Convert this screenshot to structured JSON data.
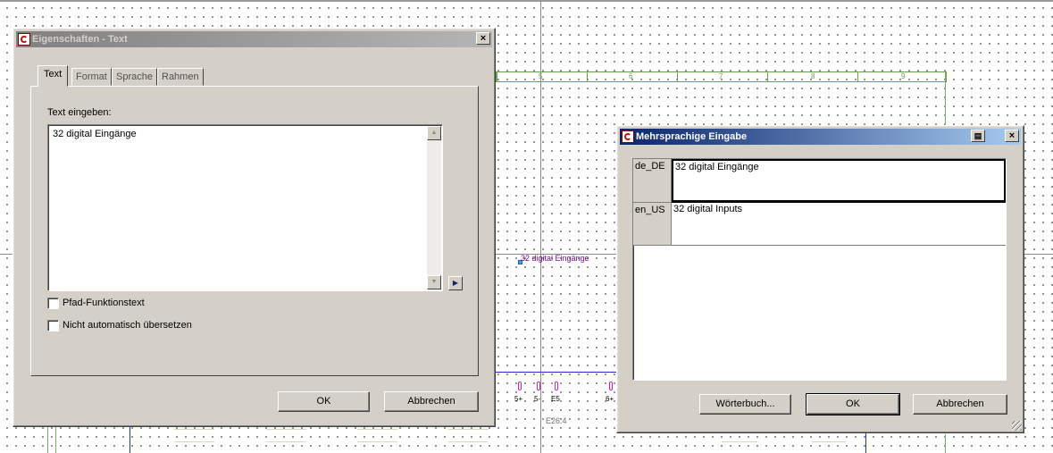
{
  "canvas": {
    "ruler_numbers": [
      "5",
      "6",
      "7",
      "8",
      "9"
    ],
    "text_label": "32 digital Eingänge",
    "terminals": [
      "5+",
      "5-",
      "E5",
      "6+"
    ],
    "device_label": "E26.4"
  },
  "props_dialog": {
    "title": "Eigenschaften - Text",
    "close_glyph": "×",
    "tabs": [
      "Text",
      "Format",
      "Sprache",
      "Rahmen"
    ],
    "text_label": "Text eingeben:",
    "text_value": "32 digital Eingänge",
    "checkbox_path": "Pfad-Funktionstext",
    "checkbox_no_translate": "Nicht automatisch übersetzen",
    "ok": "OK",
    "cancel": "Abbrechen"
  },
  "multi_dialog": {
    "title": "Mehrsprachige Eingabe",
    "close_glyph": "×",
    "rows": [
      {
        "lang": "de_DE",
        "value": "32 digital Eingänge"
      },
      {
        "lang": "en_US",
        "value": "32 digital Inputs"
      }
    ],
    "dictionary": "Wörterbuch...",
    "ok": "OK",
    "cancel": "Abbrechen"
  }
}
